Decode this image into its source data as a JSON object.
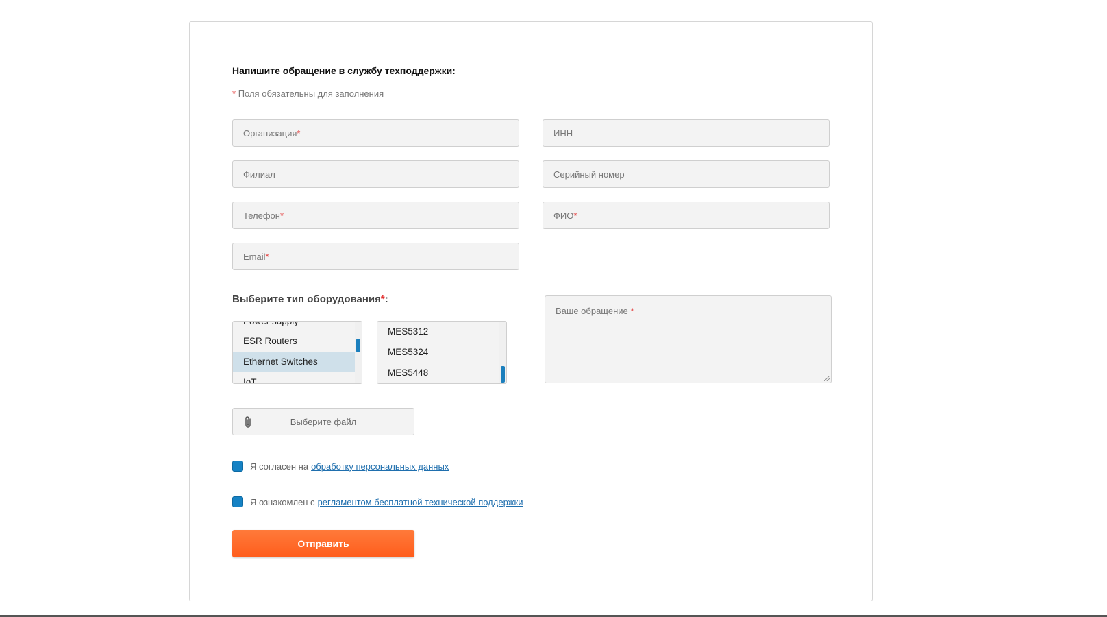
{
  "form": {
    "title": "Напишите обращение в службу техподдержки:",
    "required_star": "*",
    "required_note": "Поля обязательны для заполнения",
    "fields": {
      "organization": {
        "placeholder": "Организация",
        "required": true
      },
      "inn": {
        "placeholder": "ИНН",
        "required": false
      },
      "branch": {
        "placeholder": "Филиал",
        "required": false
      },
      "serial": {
        "placeholder": "Серийный номер",
        "required": false
      },
      "phone": {
        "placeholder": "Телефон",
        "required": true
      },
      "fio": {
        "placeholder": "ФИО",
        "required": true
      },
      "email": {
        "placeholder": "Email",
        "required": true
      }
    },
    "equipment_label": "Выберите тип оборудования",
    "equipment_label_colon": ":",
    "equipment_types": {
      "visible_options": [
        "Power supply",
        "ESR Routers",
        "Ethernet Switches",
        "IoT"
      ],
      "selected": "Ethernet Switches"
    },
    "models": {
      "visible_options": [
        "MES5312",
        "MES5324",
        "MES5448"
      ]
    },
    "message_placeholder": "Ваше обращение",
    "file_button": "Выберите файл",
    "consent": {
      "text": "Я согласен на",
      "link": "обработку персональных данных",
      "checked": true
    },
    "rules": {
      "text": "Я ознакомлен с",
      "link": "регламентом бесплатной технической поддержки",
      "checked": true
    },
    "submit_label": "Отправить"
  },
  "colors": {
    "accent": "#1682c4",
    "submit": "#ff6a2a",
    "required": "#e3302f"
  }
}
